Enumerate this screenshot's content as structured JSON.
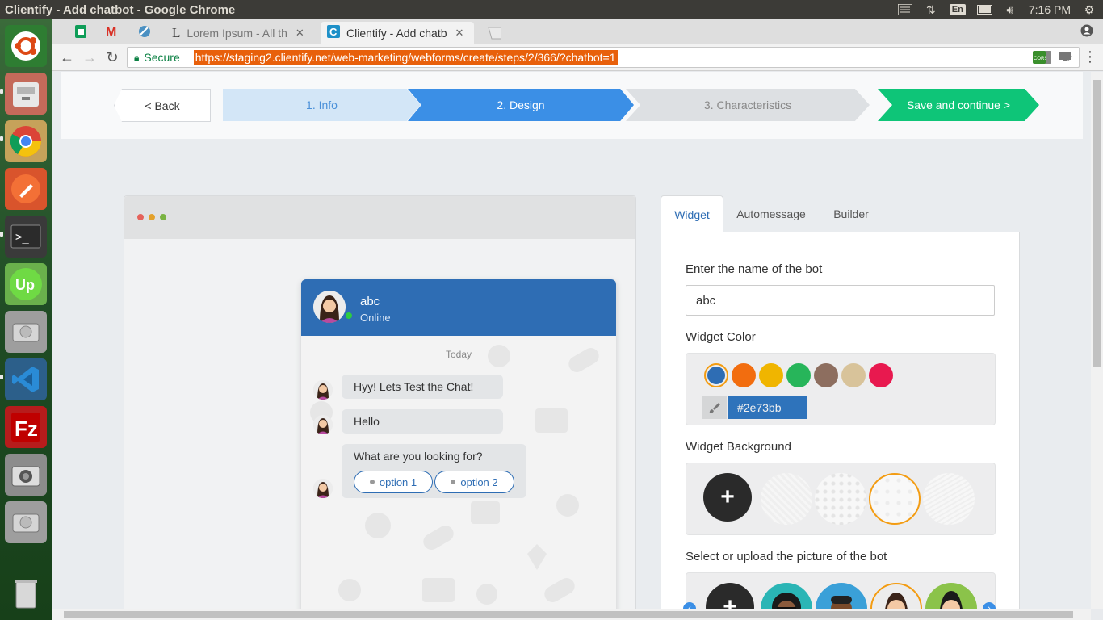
{
  "os": {
    "window_title": "Clientify - Add chatbot - Google Chrome",
    "keyboard": "En",
    "time": "7:16 PM"
  },
  "browser": {
    "tabs": [
      {
        "label": "",
        "icon": "sheets-icon"
      },
      {
        "label": "",
        "icon": "gmail-icon"
      },
      {
        "label": "",
        "icon": "meteor-icon"
      },
      {
        "label": "Lorem Ipsum - All th",
        "icon": "lorem-icon"
      },
      {
        "label": "Clientify - Add chatb",
        "icon": "clientify-icon",
        "active": true
      }
    ],
    "secure_label": "Secure",
    "url": "https://staging2.clientify.net/web-marketing/webforms/create/steps/2/366/?chatbot=1"
  },
  "steps": {
    "back": "< Back",
    "items": [
      "1. Info",
      "2. Design",
      "3. Characteristics"
    ],
    "save": "Save and continue >"
  },
  "chat": {
    "bot_name": "abc",
    "status": "Online",
    "day_label": "Today",
    "messages": [
      "Hyy! Lets Test the Chat!",
      "Hello",
      "What are you looking for?"
    ],
    "options": [
      "option 1",
      "option 2"
    ]
  },
  "panel": {
    "tabs": [
      "Widget",
      "Automessage",
      "Builder"
    ],
    "name_label": "Enter the name of the bot",
    "name_value": "abc",
    "color_label": "Widget Color",
    "colors": [
      "#2e6db4",
      "#f26d0f",
      "#f0b500",
      "#27b55a",
      "#8d6e5f",
      "#d8c39a",
      "#e8194f"
    ],
    "color_value": "#2e73bb",
    "background_label": "Widget Background",
    "picture_label": "Select or upload the picture of the bot"
  }
}
